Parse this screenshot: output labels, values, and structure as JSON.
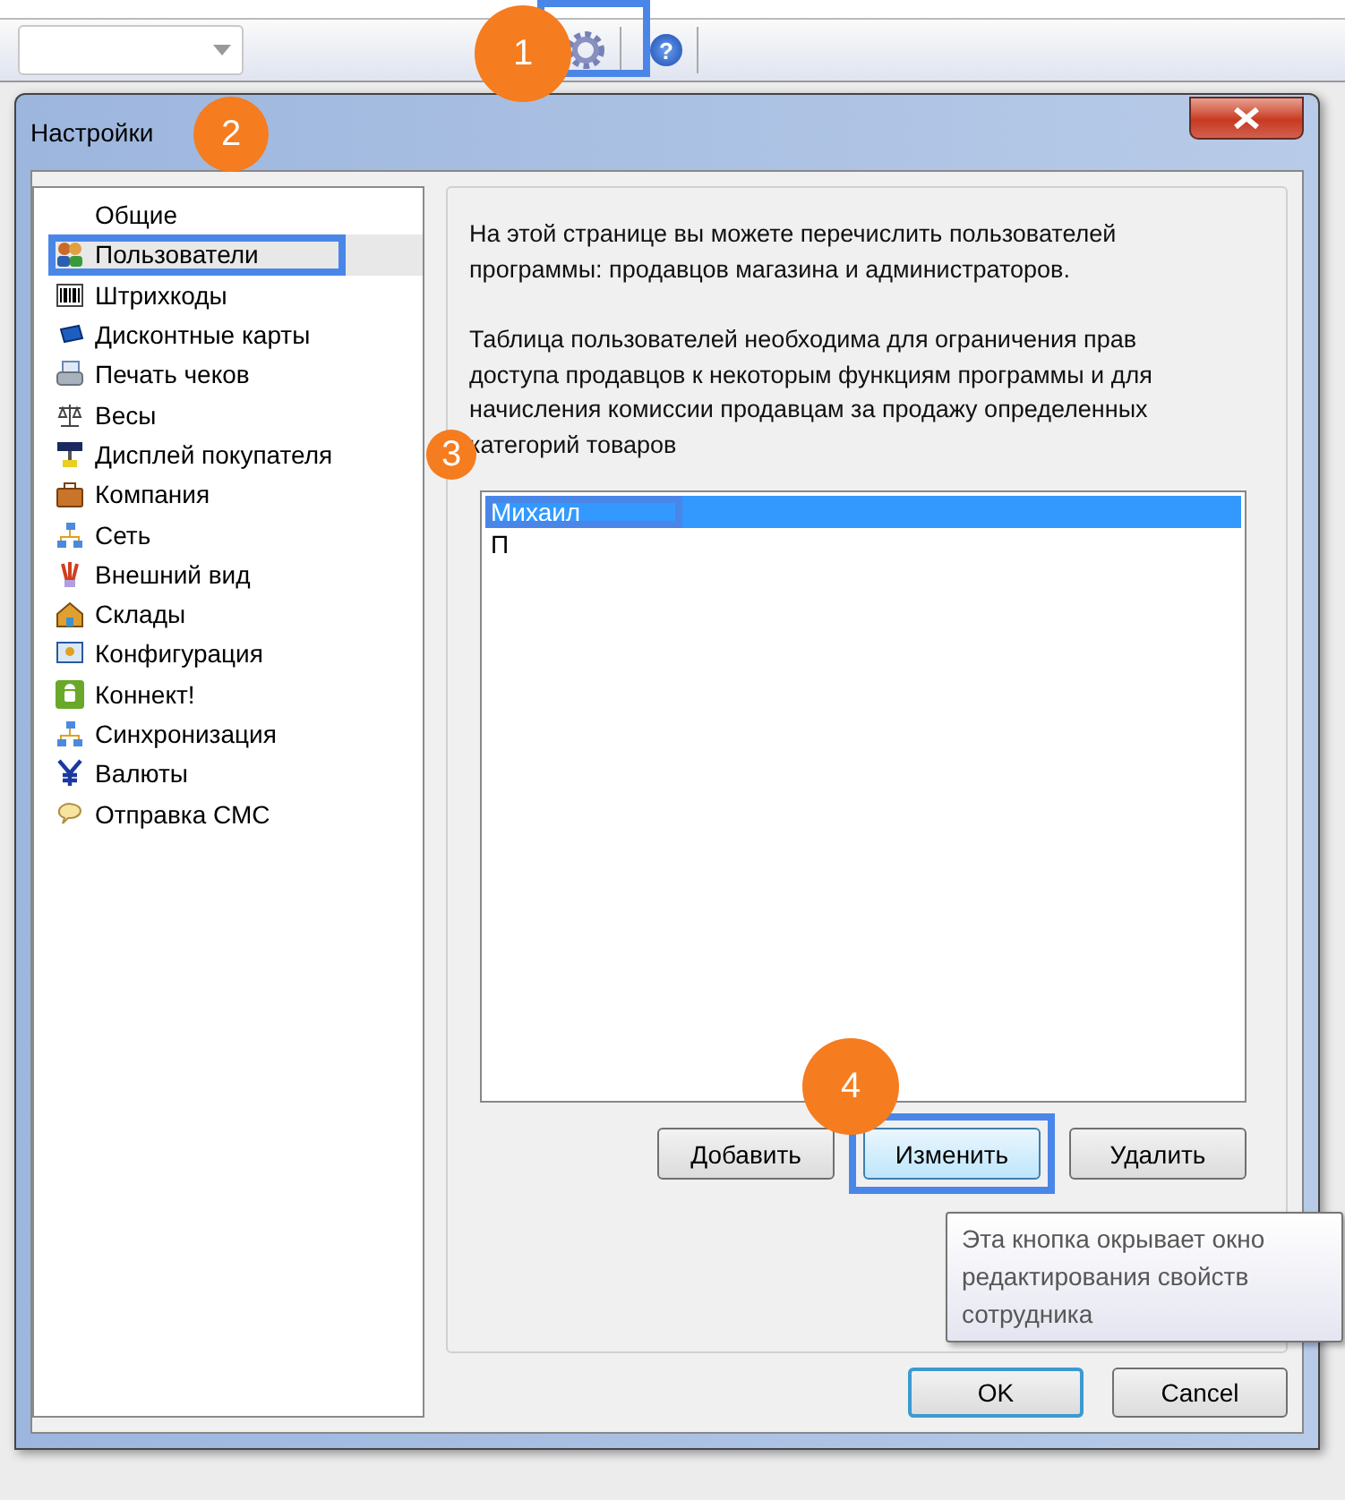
{
  "toolbar": {
    "help_button": "?"
  },
  "window": {
    "title": "Настройки"
  },
  "sidebar": {
    "items": [
      {
        "label": "Общие",
        "selected": false
      },
      {
        "label": "Пользователи",
        "selected": true
      },
      {
        "label": "Штрихкоды",
        "selected": false
      },
      {
        "label": "Дисконтные карты",
        "selected": false
      },
      {
        "label": "Печать чеков",
        "selected": false
      },
      {
        "label": "Весы",
        "selected": false
      },
      {
        "label": "Дисплей покупателя",
        "selected": false
      },
      {
        "label": "Компания",
        "selected": false
      },
      {
        "label": "Сеть",
        "selected": false
      },
      {
        "label": "Внешний вид",
        "selected": false
      },
      {
        "label": "Склады",
        "selected": false
      },
      {
        "label": "Конфигурация",
        "selected": false
      },
      {
        "label": "Коннект!",
        "selected": false
      },
      {
        "label": "Синхронизация",
        "selected": false
      },
      {
        "label": "Валюты",
        "selected": false
      },
      {
        "label": "Отправка СМС",
        "selected": false
      }
    ]
  },
  "page": {
    "paragraphs": [
      "На этой странице вы можете перечислить пользователей программы: продавцов магазина и администраторов.",
      "Таблица пользователей необходима для ограничения прав доступа продавцов к некоторым функциям программы и для начисления комиссии продавцам за продажу определенных категорий товаров"
    ],
    "users": [
      {
        "name": "Михаил",
        "selected": true
      },
      {
        "name": "П",
        "selected": false
      }
    ],
    "buttons": [
      {
        "label": "Добавить",
        "highlighted": false
      },
      {
        "label": "Изменить",
        "highlighted": true
      },
      {
        "label": "Удалить",
        "highlighted": false
      }
    ]
  },
  "tooltip": "Эта кнопка окрывает окно редактирования свойств сотрудника",
  "dialog_buttons": [
    {
      "label": "OK",
      "default": true
    },
    {
      "label": "Cancel",
      "default": false
    }
  ],
  "annotations": [
    "1",
    "2",
    "3",
    "4"
  ]
}
